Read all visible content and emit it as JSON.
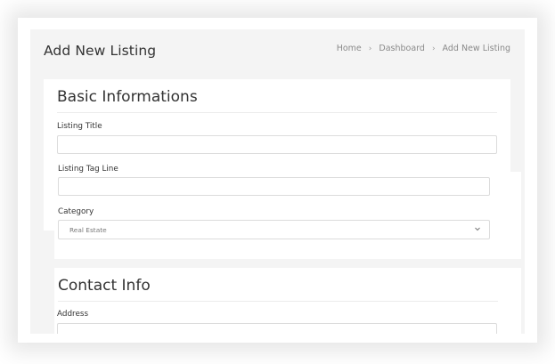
{
  "header": {
    "title": "Add New Listing",
    "breadcrumb": [
      "Home",
      "Dashboard",
      "Add New Listing"
    ],
    "separator": "›"
  },
  "basic": {
    "title": "Basic Informations",
    "listing_title_label": "Listing Title",
    "listing_title_value": "",
    "tagline_label": "Listing Tag Line",
    "tagline_value": "",
    "category_label": "Category",
    "category_selected": "Real Estate"
  },
  "contact": {
    "title": "Contact Info",
    "address_label": "Address",
    "address_value": ""
  },
  "colors": {
    "frame_bg": "#f4f4f4",
    "card_bg": "#ffffff",
    "text": "#333333",
    "muted": "#8a8a8a",
    "border": "#dcdcdc"
  },
  "icons": {
    "select_chevron": "chevron-down-icon"
  }
}
